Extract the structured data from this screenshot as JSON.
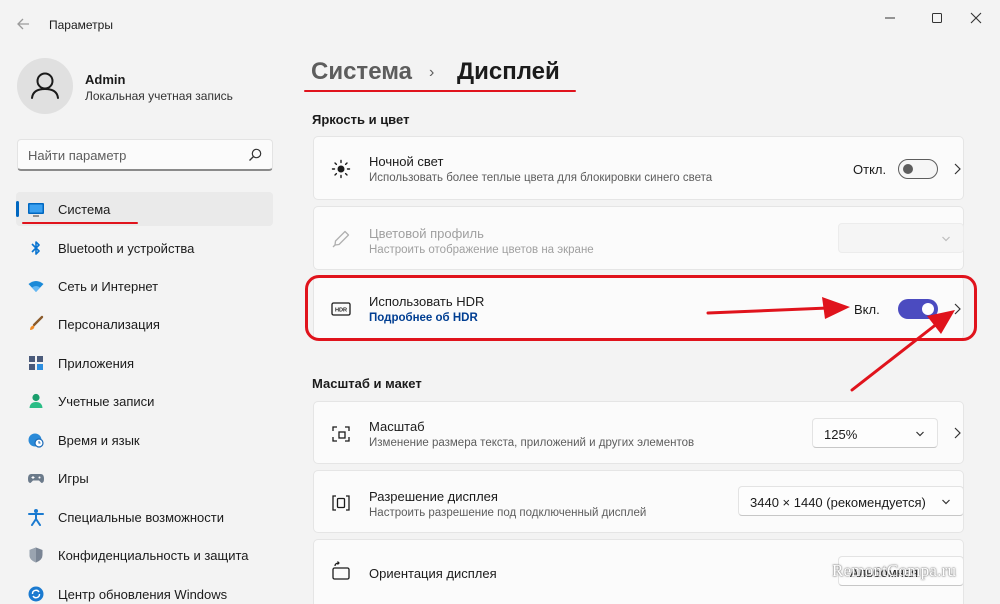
{
  "window": {
    "title": "Параметры",
    "controls": [
      "minimize",
      "maximize",
      "close"
    ]
  },
  "profile": {
    "name": "Admin",
    "account_type": "Локальная учетная запись"
  },
  "search": {
    "placeholder": "Найти параметр"
  },
  "sidebar": {
    "items": [
      {
        "label": "Система",
        "icon": "monitor-icon",
        "active": true
      },
      {
        "label": "Bluetooth и устройства",
        "icon": "bluetooth-icon"
      },
      {
        "label": "Сеть и Интернет",
        "icon": "wifi-icon"
      },
      {
        "label": "Персонализация",
        "icon": "brush-icon"
      },
      {
        "label": "Приложения",
        "icon": "apps-icon"
      },
      {
        "label": "Учетные записи",
        "icon": "person-icon"
      },
      {
        "label": "Время и язык",
        "icon": "globe-clock-icon"
      },
      {
        "label": "Игры",
        "icon": "gamepad-icon"
      },
      {
        "label": "Специальные возможности",
        "icon": "accessibility-icon"
      },
      {
        "label": "Конфиденциальность и защита",
        "icon": "shield-icon"
      },
      {
        "label": "Центр обновления Windows",
        "icon": "update-icon"
      }
    ]
  },
  "breadcrumb": {
    "parent": "Система",
    "separator": "›",
    "current": "Дисплей"
  },
  "sections": {
    "brightness": "Яркость и цвет",
    "scale_layout": "Масштаб и макет"
  },
  "cards": {
    "night_light": {
      "title": "Ночной свет",
      "subtitle": "Использовать более теплые цвета для блокировки синего света",
      "toggle_label": "Откл.",
      "toggle_on": false
    },
    "color_profile": {
      "title": "Цветовой профиль",
      "subtitle": "Настроить отображение цветов на экране",
      "disabled": true
    },
    "hdr": {
      "title": "Использовать HDR",
      "link": "Подробнее об HDR",
      "toggle_label": "Вкл.",
      "toggle_on": true,
      "icon_text": "HDR"
    },
    "scale": {
      "title": "Масштаб",
      "subtitle": "Изменение размера текста, приложений и других элементов",
      "value": "125%"
    },
    "resolution": {
      "title": "Разрешение дисплея",
      "subtitle": "Настроить разрешение под подключенный дисплей",
      "value": "3440 × 1440 (рекомендуется)"
    },
    "orientation": {
      "title": "Ориентация дисплея",
      "value": "Альбомная"
    }
  },
  "watermark": "RemontCompa.ru",
  "colors": {
    "accent": "#0067c0",
    "toggle_on": "#4b4bc0",
    "annotation_red": "#e0131c",
    "link": "#003e92"
  }
}
